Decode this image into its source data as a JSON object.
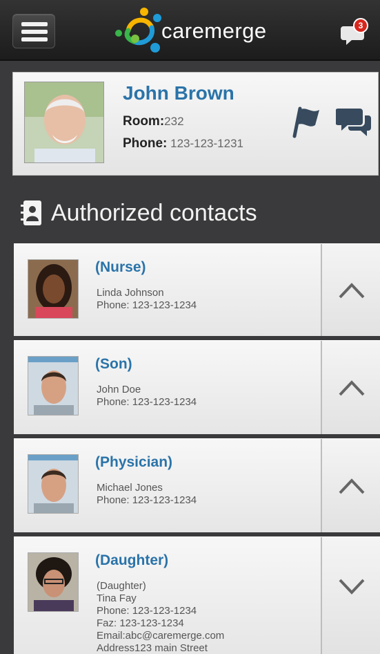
{
  "header": {
    "logo_text": "caremerge",
    "notification_count": "3",
    "icons": {
      "menu": "hamburger-menu-icon",
      "notification": "chat-notification-icon"
    }
  },
  "patient": {
    "name": "John Brown",
    "room_label": "Room:",
    "room_value": "232",
    "phone_label": "Phone:",
    "phone_value": "123-123-1231",
    "icons": {
      "flag": "flag-icon",
      "chat": "chat-icon"
    }
  },
  "section": {
    "title": "Authorized contacts",
    "icon": "address-book-icon"
  },
  "contacts": [
    {
      "role": "(Nurse)",
      "lines": [
        "Linda Johnson",
        "Phone: 123-123-1234"
      ],
      "expanded": false
    },
    {
      "role": "(Son)",
      "lines": [
        "John Doe",
        "Phone: 123-123-1234"
      ],
      "expanded": false
    },
    {
      "role": "(Physician)",
      "lines": [
        "Michael Jones",
        "Phone: 123-123-1234"
      ],
      "expanded": false
    },
    {
      "role": "(Daughter)",
      "lines": [
        "(Daughter)",
        "Tina Fay",
        "Phone: 123-123-1234",
        "Faz: 123-123-1234",
        "Email:abc@caremerge.com",
        "Address123 main Street"
      ],
      "expanded": true
    }
  ],
  "colors": {
    "accent": "#2a73a9",
    "topbar": "#2a2a2a",
    "background": "#3a3a3c",
    "badge": "#d9261c"
  }
}
